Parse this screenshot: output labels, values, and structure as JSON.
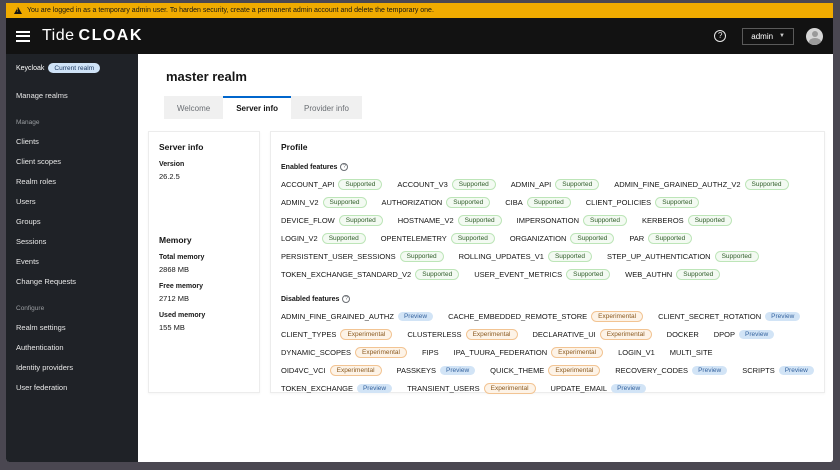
{
  "banner": {
    "text": "You are logged in as a temporary admin user. To harden security, create a permanent admin account and delete the temporary one."
  },
  "header": {
    "brand_tide": "Tide",
    "brand_cloak": "CLOAK",
    "user_menu_label": "admin"
  },
  "sidebar": {
    "realm_name": "Keycloak",
    "realm_badge": "Current realm",
    "top_items": [
      "Manage realms"
    ],
    "groups": [
      {
        "label": "Manage",
        "items": [
          "Clients",
          "Client scopes",
          "Realm roles",
          "Users",
          "Groups",
          "Sessions",
          "Events",
          "Change Requests"
        ]
      },
      {
        "label": "Configure",
        "items": [
          "Realm settings",
          "Authentication",
          "Identity providers",
          "User federation"
        ]
      }
    ]
  },
  "page": {
    "title": "master realm",
    "tabs": [
      {
        "label": "Welcome"
      },
      {
        "label": "Server info"
      },
      {
        "label": "Provider info"
      }
    ]
  },
  "server_info": {
    "heading": "Server info",
    "version_label": "Version",
    "version_value": "26.2.5",
    "memory_heading": "Memory",
    "total_label": "Total memory",
    "total_value": "2868 MB",
    "free_label": "Free memory",
    "free_value": "2712 MB",
    "used_label": "Used memory",
    "used_value": "155 MB"
  },
  "profile": {
    "heading": "Profile",
    "enabled_heading": "Enabled features",
    "disabled_heading": "Disabled features",
    "enabled_features": [
      {
        "name": "ACCOUNT_API",
        "badge": "Supported"
      },
      {
        "name": "ACCOUNT_V3",
        "badge": "Supported"
      },
      {
        "name": "ADMIN_API",
        "badge": "Supported"
      },
      {
        "name": "ADMIN_FINE_GRAINED_AUTHZ_V2",
        "badge": "Supported"
      },
      {
        "name": "ADMIN_V2",
        "badge": "Supported"
      },
      {
        "name": "AUTHORIZATION",
        "badge": "Supported"
      },
      {
        "name": "CIBA",
        "badge": "Supported"
      },
      {
        "name": "CLIENT_POLICIES",
        "badge": "Supported"
      },
      {
        "name": "DEVICE_FLOW",
        "badge": "Supported"
      },
      {
        "name": "HOSTNAME_V2",
        "badge": "Supported"
      },
      {
        "name": "IMPERSONATION",
        "badge": "Supported"
      },
      {
        "name": "KERBEROS",
        "badge": "Supported"
      },
      {
        "name": "LOGIN_V2",
        "badge": "Supported"
      },
      {
        "name": "OPENTELEMETRY",
        "badge": "Supported"
      },
      {
        "name": "ORGANIZATION",
        "badge": "Supported"
      },
      {
        "name": "PAR",
        "badge": "Supported"
      },
      {
        "name": "PERSISTENT_USER_SESSIONS",
        "badge": "Supported"
      },
      {
        "name": "ROLLING_UPDATES_V1",
        "badge": "Supported"
      },
      {
        "name": "STEP_UP_AUTHENTICATION",
        "badge": "Supported"
      },
      {
        "name": "TOKEN_EXCHANGE_STANDARD_V2",
        "badge": "Supported"
      },
      {
        "name": "USER_EVENT_METRICS",
        "badge": "Supported"
      },
      {
        "name": "WEB_AUTHN",
        "badge": "Supported"
      }
    ],
    "disabled_features": [
      {
        "name": "ADMIN_FINE_GRAINED_AUTHZ",
        "badge": "Preview"
      },
      {
        "name": "CACHE_EMBEDDED_REMOTE_STORE",
        "badge": "Experimental"
      },
      {
        "name": "CLIENT_SECRET_ROTATION",
        "badge": "Preview"
      },
      {
        "name": "CLIENT_TYPES",
        "badge": "Experimental"
      },
      {
        "name": "CLUSTERLESS",
        "badge": "Experimental"
      },
      {
        "name": "DECLARATIVE_UI",
        "badge": "Experimental"
      },
      {
        "name": "DOCKER",
        "badge": ""
      },
      {
        "name": "DPOP",
        "badge": "Preview"
      },
      {
        "name": "DYNAMIC_SCOPES",
        "badge": "Experimental"
      },
      {
        "name": "FIPS",
        "badge": ""
      },
      {
        "name": "IPA_TUURA_FEDERATION",
        "badge": "Experimental"
      },
      {
        "name": "LOGIN_V1",
        "badge": ""
      },
      {
        "name": "MULTI_SITE",
        "badge": ""
      },
      {
        "name": "OID4VC_VCI",
        "badge": "Experimental"
      },
      {
        "name": "PASSKEYS",
        "badge": "Preview"
      },
      {
        "name": "QUICK_THEME",
        "badge": "Experimental"
      },
      {
        "name": "RECOVERY_CODES",
        "badge": "Preview"
      },
      {
        "name": "SCRIPTS",
        "badge": "Preview"
      },
      {
        "name": "TOKEN_EXCHANGE",
        "badge": "Preview"
      },
      {
        "name": "TRANSIENT_USERS",
        "badge": "Experimental"
      },
      {
        "name": "UPDATE_EMAIL",
        "badge": "Preview"
      }
    ]
  },
  "colors": {
    "banner_bg": "#f0ab00",
    "accent_blue": "#0066cc",
    "supported_bg": "#f3faf2",
    "supported_text": "#2f5c28",
    "preview_bg": "#d2e4f6",
    "preview_text": "#36649f",
    "experimental_bg": "#fdf3e7",
    "experimental_text": "#8a5a20"
  }
}
